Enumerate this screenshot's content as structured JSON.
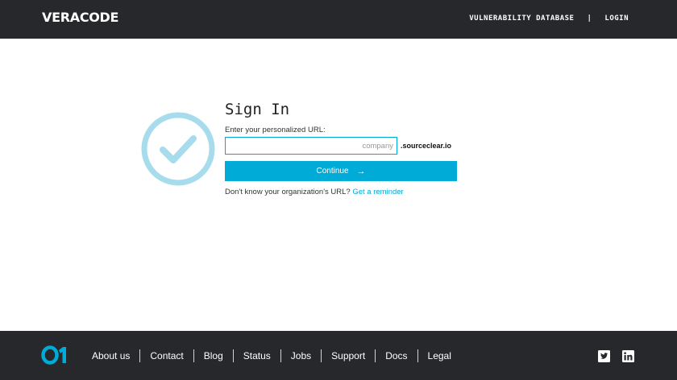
{
  "header": {
    "logo_text": "VERACODE",
    "nav": {
      "vulnerability_database": "VULNERABILITY DATABASE",
      "separator": "|",
      "login": "LOGIN"
    }
  },
  "signin": {
    "title": "Sign In",
    "url_label": "Enter your personalized URL:",
    "url_input_value": "",
    "url_input_placeholder": "company",
    "domain_suffix": ".sourceclear.io",
    "continue_label": "Continue",
    "continue_icon": "arrow-right-icon",
    "reminder_prefix": "Don't know your organization's URL?",
    "reminder_link": "Get a reminder"
  },
  "footer": {
    "logo_text": "O1",
    "links": [
      "About us",
      "Contact",
      "Blog",
      "Status",
      "Jobs",
      "Support",
      "Docs",
      "Legal"
    ],
    "social": [
      "twitter-icon",
      "linkedin-icon"
    ]
  },
  "colors": {
    "header_bg": "#26282b",
    "accent": "#00abd8",
    "check_circle": "#a6dcec"
  }
}
